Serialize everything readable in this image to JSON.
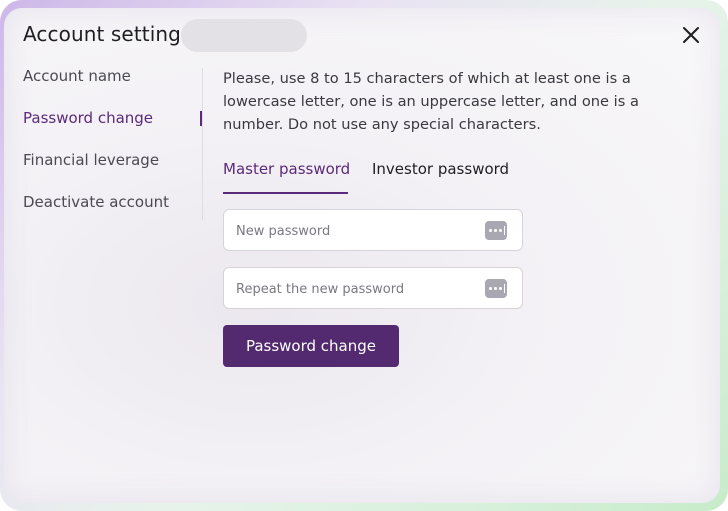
{
  "dialog": {
    "title": "Account settings",
    "close_icon": "close-icon"
  },
  "sidebar": {
    "items": [
      {
        "label": "Account name"
      },
      {
        "label": "Password change",
        "active": true
      },
      {
        "label": "Financial leverage"
      },
      {
        "label": "Deactivate account"
      }
    ]
  },
  "main": {
    "hint": "Please, use 8 to 15 characters of which at least one is a lowercase letter, one is an uppercase letter, and one is a number. Do not use any special characters.",
    "tabs": [
      {
        "label": "Master password",
        "active": true
      },
      {
        "label": "Investor password"
      }
    ],
    "new_password": {
      "value": "",
      "placeholder": "New password",
      "icon": "password-dots-icon"
    },
    "repeat_password": {
      "value": "",
      "placeholder": "Repeat the new password",
      "icon": "password-dots-icon"
    },
    "submit_label": "Password change"
  },
  "colors": {
    "accent": "#5b2a7a",
    "button": "#532a6f"
  }
}
